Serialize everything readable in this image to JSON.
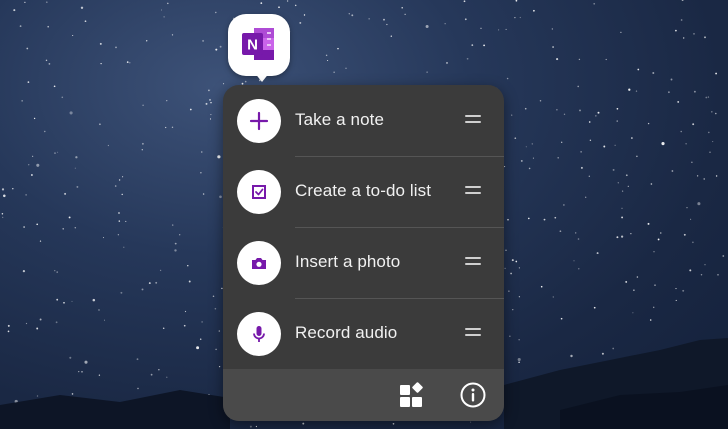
{
  "app": {
    "name": "OneNote",
    "icon": "onenote-icon",
    "brand_color": "#7719aa"
  },
  "shortcuts": [
    {
      "label": "Take a note",
      "icon": "plus-icon"
    },
    {
      "label": "Create a to-do list",
      "icon": "checkbox-icon"
    },
    {
      "label": "Insert a photo",
      "icon": "camera-icon"
    },
    {
      "label": "Record audio",
      "icon": "microphone-icon"
    }
  ],
  "footer": {
    "widgets_icon": "widgets-icon",
    "app_info_icon": "info-icon"
  },
  "colors": {
    "popup_background": "#3b3b3b",
    "footer_background": "#4a4a4a",
    "accent": "#7719aa"
  }
}
